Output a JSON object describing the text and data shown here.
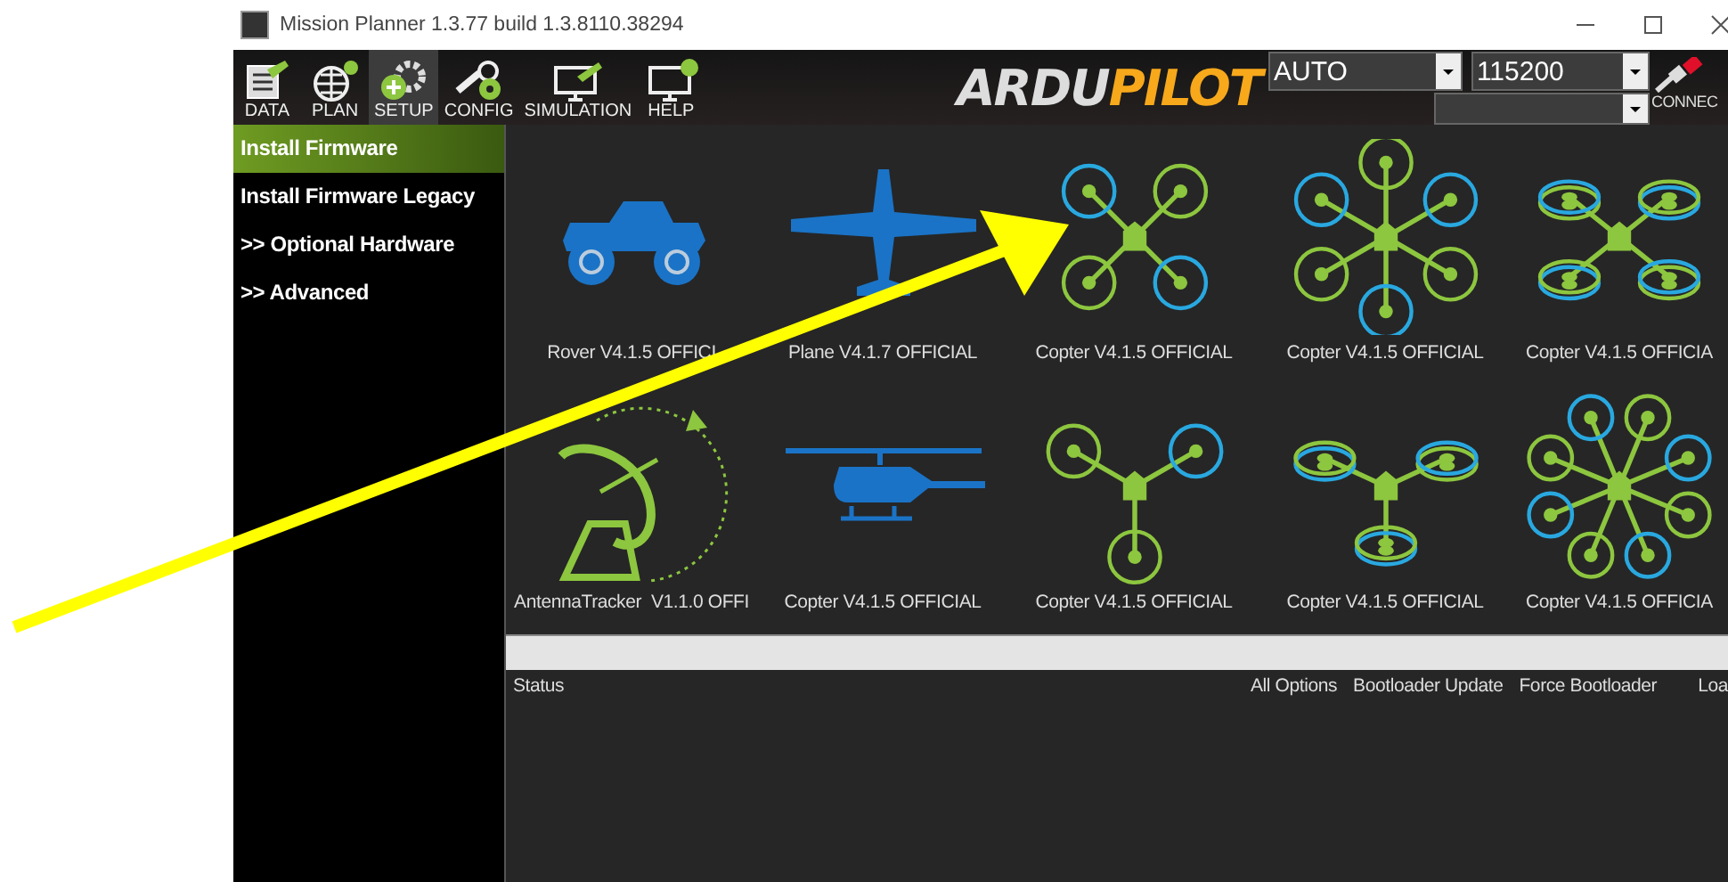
{
  "window": {
    "title": "Mission Planner 1.3.77 build 1.3.8110.38294"
  },
  "toolbar": [
    {
      "kind": "data",
      "label": "DATA",
      "selected": false
    },
    {
      "kind": "plan",
      "label": "PLAN",
      "selected": false
    },
    {
      "kind": "setup",
      "label": "SETUP",
      "selected": true
    },
    {
      "kind": "config",
      "label": "CONFIG",
      "selected": false
    },
    {
      "kind": "simulation",
      "label": "SIMULATION",
      "selected": false
    },
    {
      "kind": "help",
      "label": "HELP",
      "selected": false
    }
  ],
  "logo": {
    "text_1": "ARDU",
    "text_2": "PILOT"
  },
  "connection": {
    "mode": "AUTO",
    "baud": "115200",
    "connect_label": "CONNEC"
  },
  "sidebar": {
    "items": [
      {
        "label": "Install Firmware",
        "selected": true
      },
      {
        "label": "Install Firmware Legacy",
        "selected": false
      },
      {
        "label": ">> Optional Hardware",
        "selected": false
      },
      {
        "label": ">> Advanced",
        "selected": false
      }
    ]
  },
  "firmware": [
    {
      "kind": "rover",
      "label": "Rover V4.1.5 OFFICI"
    },
    {
      "kind": "plane",
      "label": "Plane V4.1.7 OFFICIAL"
    },
    {
      "kind": "quad",
      "label": "Copter V4.1.5 OFFICIAL"
    },
    {
      "kind": "hexa",
      "label": "Copter V4.1.5 OFFICIAL"
    },
    {
      "kind": "x8",
      "label": "Copter V4.1.5 OFFICIA"
    },
    {
      "kind": "tracker",
      "label": "AntennaTracker  V1.1.0 OFFI"
    },
    {
      "kind": "heli",
      "label": "Copter V4.1.5 OFFICIAL"
    },
    {
      "kind": "tri",
      "label": "Copter V4.1.5 OFFICIAL"
    },
    {
      "kind": "y6",
      "label": "Copter V4.1.5 OFFICIAL"
    },
    {
      "kind": "octa",
      "label": "Copter V4.1.5 OFFICIA"
    }
  ],
  "status": {
    "label": "Status",
    "actions": [
      "All Options",
      "Bootloader Update",
      "Force Bootloader",
      "Loa"
    ]
  }
}
